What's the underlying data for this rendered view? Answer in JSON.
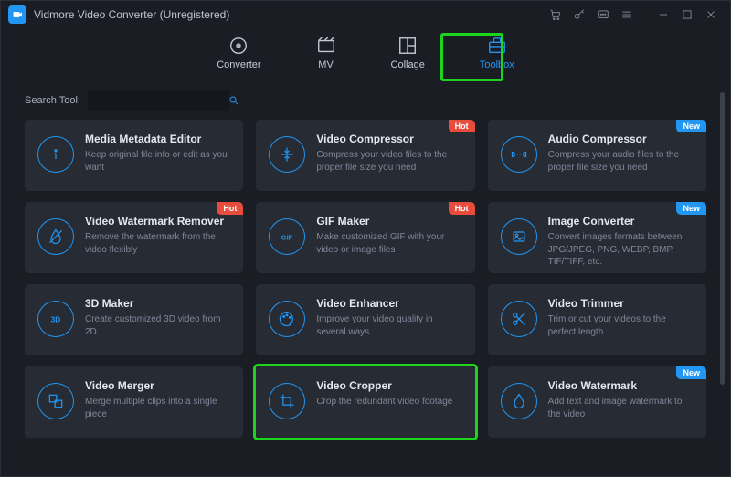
{
  "titlebar": {
    "title": "Vidmore Video Converter (Unregistered)"
  },
  "nav": {
    "items": [
      {
        "label": "Converter",
        "icon": "converter-icon"
      },
      {
        "label": "MV",
        "icon": "mv-icon"
      },
      {
        "label": "Collage",
        "icon": "collage-icon"
      },
      {
        "label": "Toolbox",
        "icon": "toolbox-icon",
        "active": true
      }
    ]
  },
  "search": {
    "label": "Search Tool:",
    "placeholder": ""
  },
  "tools": [
    {
      "title": "Media Metadata Editor",
      "desc": "Keep original file info or edit as you want",
      "icon": "info-icon",
      "badge": null
    },
    {
      "title": "Video Compressor",
      "desc": "Compress your video files to the proper file size you need",
      "icon": "compress-icon",
      "badge": "Hot"
    },
    {
      "title": "Audio Compressor",
      "desc": "Compress your audio files to the proper file size you need",
      "icon": "audio-compress-icon",
      "badge": "New"
    },
    {
      "title": "Video Watermark Remover",
      "desc": "Remove the watermark from the video flexibly",
      "icon": "water-drop-icon",
      "badge": "Hot"
    },
    {
      "title": "GIF Maker",
      "desc": "Make customized GIF with your video or image files",
      "icon": "gif-icon",
      "badge": "Hot"
    },
    {
      "title": "Image Converter",
      "desc": "Convert images formats between JPG/JPEG, PNG, WEBP, BMP, TIF/TIFF, etc.",
      "icon": "image-icon",
      "badge": "New"
    },
    {
      "title": "3D Maker",
      "desc": "Create customized 3D video from 2D",
      "icon": "3d-icon",
      "badge": null
    },
    {
      "title": "Video Enhancer",
      "desc": "Improve your video quality in several ways",
      "icon": "palette-icon",
      "badge": null
    },
    {
      "title": "Video Trimmer",
      "desc": "Trim or cut your videos to the perfect length",
      "icon": "scissors-icon",
      "badge": null
    },
    {
      "title": "Video Merger",
      "desc": "Merge multiple clips into a single piece",
      "icon": "merge-icon",
      "badge": null
    },
    {
      "title": "Video Cropper",
      "desc": "Crop the redundant video footage",
      "icon": "crop-icon",
      "badge": null
    },
    {
      "title": "Video Watermark",
      "desc": "Add text and image watermark to the video",
      "icon": "watermark-icon",
      "badge": "New"
    }
  ],
  "highlights": {
    "toolbox_tab": true,
    "video_cropper_card": true
  },
  "colors": {
    "accent": "#2196f3",
    "highlight": "#1dd41d",
    "badge_hot": "#e74c3c",
    "badge_new": "#2196f3"
  }
}
